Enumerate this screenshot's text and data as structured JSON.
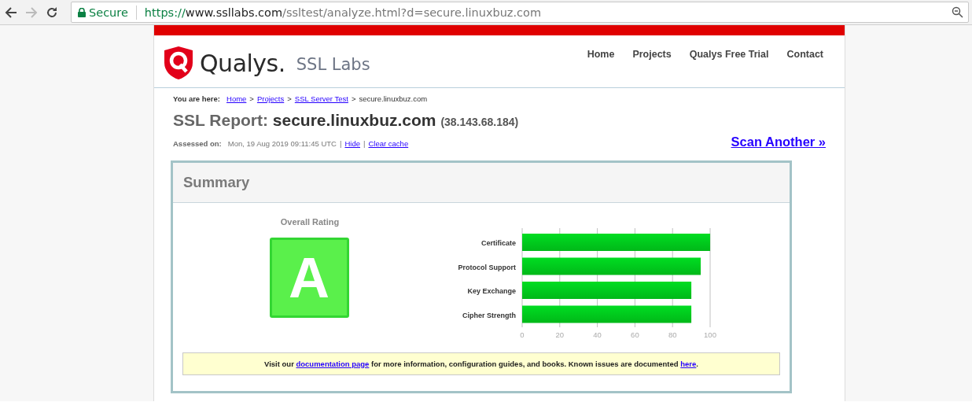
{
  "browser": {
    "security_label": "Secure",
    "url_scheme": "https://",
    "url_host": "www.ssllabs.com",
    "url_path": "/ssltest/analyze.html?d=secure.linuxbuz.com"
  },
  "header": {
    "logo_word": "Qualys.",
    "logo_sub": "SSL Labs",
    "nav": [
      "Home",
      "Projects",
      "Qualys Free Trial",
      "Contact"
    ]
  },
  "breadcrumb": {
    "label": "You are here:",
    "links": [
      "Home",
      "Projects",
      "SSL Server Test"
    ],
    "separators": [
      ">",
      ">",
      ">"
    ],
    "current": "secure.linuxbuz.com"
  },
  "report": {
    "title_prefix": "SSL Report:",
    "host": "secure.linuxbuz.com",
    "ip": "(38.143.68.184)",
    "assessed_label": "Assessed on:",
    "assessed_value": "Mon, 19 Aug 2019 09:11:45 UTC",
    "separators": [
      "|",
      "|"
    ],
    "links": [
      "Hide",
      "Clear cache"
    ],
    "scan_another": "Scan Another »"
  },
  "summary": {
    "title": "Summary",
    "rating_label": "Overall Rating",
    "grade": "A",
    "chart_data": {
      "type": "bar",
      "orientation": "horizontal",
      "grid": true,
      "categories": [
        "Certificate",
        "Protocol Support",
        "Key Exchange",
        "Cipher Strength"
      ],
      "series": [
        {
          "color": "#00dd22",
          "values": [
            100,
            95,
            90,
            90
          ]
        }
      ],
      "xlim": [
        0,
        100
      ],
      "xticks": [
        0,
        20,
        40,
        60,
        80,
        100
      ]
    },
    "notice": {
      "before": "Visit our",
      "link": "documentation page",
      "middle": "for more information, configuration guides, and books. Known issues are documented",
      "link_2": "here",
      "after": "."
    }
  }
}
